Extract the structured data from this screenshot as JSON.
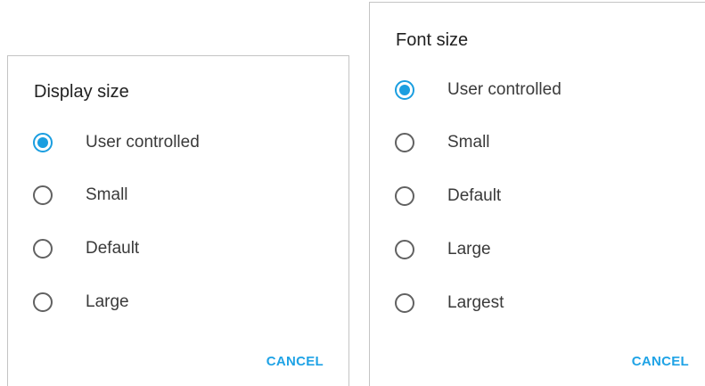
{
  "display_dialog": {
    "title": "Display size",
    "options": [
      {
        "label": "User controlled",
        "selected": true
      },
      {
        "label": "Small",
        "selected": false
      },
      {
        "label": "Default",
        "selected": false
      },
      {
        "label": "Large",
        "selected": false
      }
    ],
    "cancel_label": "CANCEL"
  },
  "font_dialog": {
    "title": "Font size",
    "options": [
      {
        "label": "User controlled",
        "selected": true
      },
      {
        "label": "Small",
        "selected": false
      },
      {
        "label": "Default",
        "selected": false
      },
      {
        "label": "Large",
        "selected": false
      },
      {
        "label": "Largest",
        "selected": false
      }
    ],
    "cancel_label": "CANCEL"
  },
  "colors": {
    "accent": "#1a9ee0",
    "radio_unchecked": "#616161",
    "text": "#3a3a3a"
  }
}
